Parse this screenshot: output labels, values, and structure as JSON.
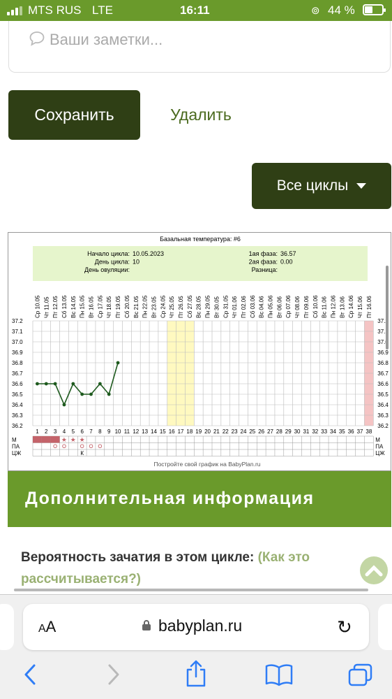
{
  "status": {
    "carrier": "MTS RUS",
    "network": "LTE",
    "time": "16:11",
    "battery": "44 %",
    "battery_level": 0.44
  },
  "notes": {
    "placeholder": "Ваши заметки...",
    "icon": "speech-bubble-icon"
  },
  "actions": {
    "save": "Сохранить",
    "delete": "Удалить",
    "all_cycles": "Все циклы"
  },
  "chart_data": {
    "type": "line",
    "title": "Базальная температура: #6",
    "info": {
      "cycle_start_label": "Начало цикла:",
      "cycle_start": "10.05.2023",
      "cycle_day_label": "День цикла:",
      "cycle_day": "10",
      "ovulation_day_label": "День овуляции:",
      "ovulation_day": "",
      "phase1_label": "1ая фаза:",
      "phase1": "36.57",
      "phase2_label": "2ая фаза:",
      "phase2": "0.00",
      "diff_label": "Разница:",
      "diff": ""
    },
    "dates": [
      "Ср 10.05",
      "Чт 11.05",
      "Пт 12.05",
      "Сб 13.05",
      "Вс 14.05",
      "Пн 15.05",
      "Вт 16.05",
      "Ср 17.05",
      "Чт 18.05",
      "Пт 19.05",
      "Сб 20.05",
      "Вс 21.05",
      "Пн 22.05",
      "Вт 23.05",
      "Ср 24.05",
      "Чт 25.05",
      "Пт 26.05",
      "Сб 27.05",
      "Вс 28.05",
      "Пн 29.05",
      "Вт 30.05",
      "Ср 31.05",
      "Чт 01.06",
      "Пт 02.06",
      "Сб 03.06",
      "Вс 04.06",
      "Пн 05.06",
      "Вт 06.06",
      "Ср 07.06",
      "Чт 08.06",
      "Пт 09.06",
      "Сб 10.06",
      "Вс 11.06",
      "Пн 12.06",
      "Вт 13.06",
      "Ср 14.06",
      "Чт 15.06",
      "Пт 16.06"
    ],
    "days": [
      1,
      2,
      3,
      4,
      5,
      6,
      7,
      8,
      9,
      10,
      11,
      12,
      13,
      14,
      15,
      16,
      17,
      18,
      19,
      20,
      21,
      22,
      23,
      24,
      25,
      26,
      27,
      28,
      29,
      30,
      31,
      32,
      33,
      34,
      35,
      36,
      37,
      38
    ],
    "y_ticks": [
      "37.2",
      "37.1",
      "37.0",
      "36.9",
      "36.8",
      "36.7",
      "36.6",
      "36.5",
      "36.4",
      "36.3",
      "36.2"
    ],
    "ylim": [
      36.2,
      37.2
    ],
    "temps": [
      36.6,
      36.6,
      36.6,
      36.4,
      36.6,
      36.5,
      36.5,
      36.6,
      36.5,
      36.8
    ],
    "highlight_days": [
      16,
      17,
      18
    ],
    "highlight_end_day": 38,
    "row_labels": [
      "М",
      "ПА",
      "ЦЖ"
    ],
    "menses_days": [
      1,
      2,
      3
    ],
    "menses_stars": [
      4,
      5,
      6
    ],
    "pa_circle_days": [
      3,
      4,
      6,
      7,
      8
    ],
    "k_day": 6,
    "k_label": "К",
    "footer": "Постройте свой график на BabyPlan.ru",
    "colors": {
      "line": "#1e5a1e",
      "info_bg": "#e6f5cc",
      "highlight": "#fff9c0",
      "end": "#f5c4c4",
      "menses": "#c4636a"
    }
  },
  "info": {
    "header": "Дополнительная информация",
    "probability_label": "Вероятность зачатия в этом цикле:",
    "probability_link": "(Как это рассчитывается?)"
  },
  "browser": {
    "aa_small": "A",
    "aa_big": "A",
    "url": "babyplan.ru"
  }
}
